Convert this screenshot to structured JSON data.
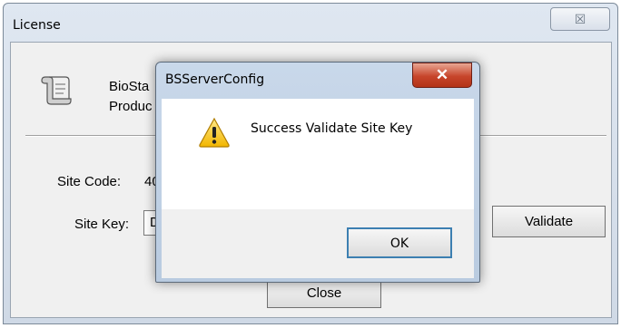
{
  "license_window": {
    "title": "License",
    "close_glyph": "☒",
    "app_name": "BioSta",
    "product_label": "Produc",
    "site_code_label": "Site Code:",
    "site_code_value": "40",
    "site_key_label": "Site Key:",
    "site_key_value": "D",
    "validate_label": "Validate",
    "close_label": "Close"
  },
  "dialog": {
    "title": "BSServerConfig",
    "close_glyph": "✕",
    "message": "Success Validate Site Key",
    "icon": "warning-icon",
    "ok_label": "OK"
  }
}
